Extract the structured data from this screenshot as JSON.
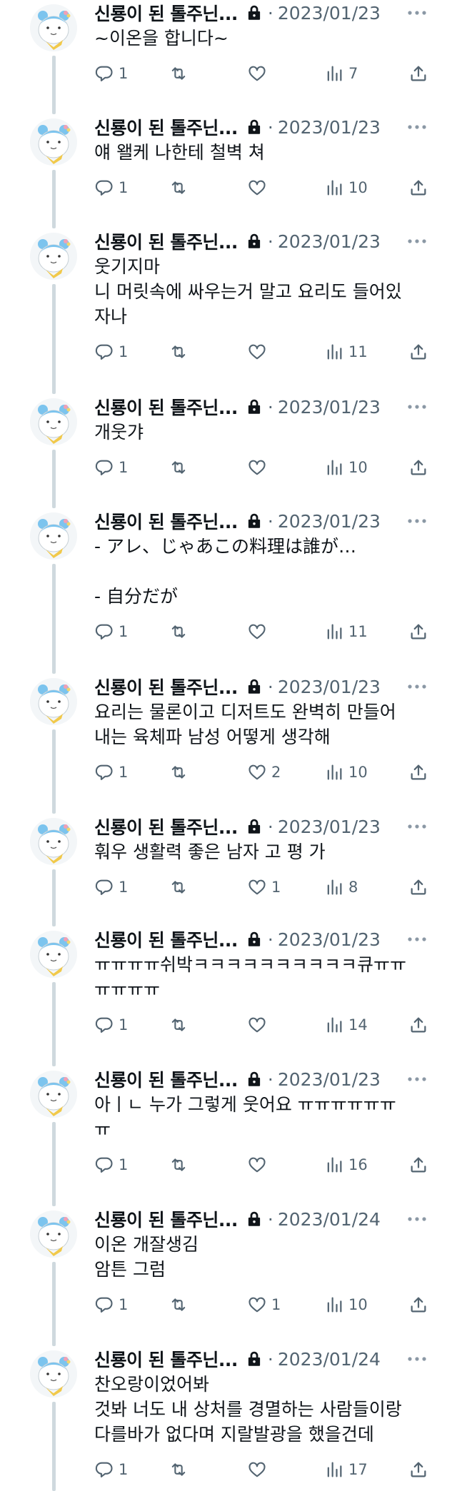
{
  "colors": {
    "text": "#0f1419",
    "muted": "#536471",
    "thread": "#cfd9de"
  },
  "icons": {
    "reply": "reply-icon",
    "retweet": "retweet-icon",
    "like": "heart-icon",
    "views": "views-icon",
    "share": "share-icon",
    "more": "more-icon",
    "lock": "lock-icon"
  },
  "tweets": [
    {
      "name": "신룡이 된 톨주닌...",
      "date": "2023/01/23",
      "text": "~이온을 합니다~",
      "replies": "1",
      "retweets": "",
      "likes": "",
      "views": "7"
    },
    {
      "name": "신룡이 된 톨주닌...",
      "date": "2023/01/23",
      "text": "얘 왤케 나한테 철벽 쳐",
      "replies": "1",
      "retweets": "",
      "likes": "",
      "views": "10"
    },
    {
      "name": "신룡이 된 톨주닌...",
      "date": "2023/01/23",
      "text": "웃기지마\n니 머릿속에 싸우는거 말고 요리도 들어있\n자나",
      "replies": "1",
      "retweets": "",
      "likes": "",
      "views": "11"
    },
    {
      "name": "신룡이 된 톨주닌...",
      "date": "2023/01/23",
      "text": "개웃갸",
      "replies": "1",
      "retweets": "",
      "likes": "",
      "views": "10"
    },
    {
      "name": "신룡이 된 톨주닌...",
      "date": "2023/01/23",
      "text": "- アレ、じゃあこの料理は誰が…\n\n- 自分だが",
      "replies": "1",
      "retweets": "",
      "likes": "",
      "views": "11"
    },
    {
      "name": "신룡이 된 톨주닌...",
      "date": "2023/01/23",
      "text": "요리는 물론이고 디저트도 완벽히 만들어\n내는 육체파 남성 어떻게 생각해",
      "replies": "1",
      "retweets": "",
      "likes": "2",
      "views": "10"
    },
    {
      "name": "신룡이 된 톨주닌...",
      "date": "2023/01/23",
      "text": "훠우 생활력 좋은 남자 고 평 가",
      "replies": "1",
      "retweets": "",
      "likes": "1",
      "views": "8"
    },
    {
      "name": "신룡이 된 톨주닌...",
      "date": "2023/01/23",
      "text": "ㅠㅠㅠㅠ쉬박ㅋㅋㅋㅋㅋㅋㅋㅋㅋㅋ큐ㅠㅠ\nㅠㅠㅠㅠ",
      "replies": "1",
      "retweets": "",
      "likes": "",
      "views": "14"
    },
    {
      "name": "신룡이 된 톨주닌...",
      "date": "2023/01/23",
      "text": "아ㅣㄴ 누가 그렇게 웃어요 ㅠㅠㅠㅠㅠㅠ\nㅠ",
      "replies": "1",
      "retweets": "",
      "likes": "",
      "views": "16"
    },
    {
      "name": "신룡이 된 톨주닌...",
      "date": "2023/01/24",
      "text": "이온 개잘생김\n암튼 그럼",
      "replies": "1",
      "retweets": "",
      "likes": "1",
      "views": "10"
    },
    {
      "name": "신룡이 된 톨주닌...",
      "date": "2023/01/24",
      "text": "찬오랑이었어봐\n것봐 너도 내 상처를 경멸하는 사람들이랑\n다를바가 없다며 지랄발광을 했을건데",
      "replies": "1",
      "retweets": "",
      "likes": "",
      "views": "17"
    }
  ]
}
